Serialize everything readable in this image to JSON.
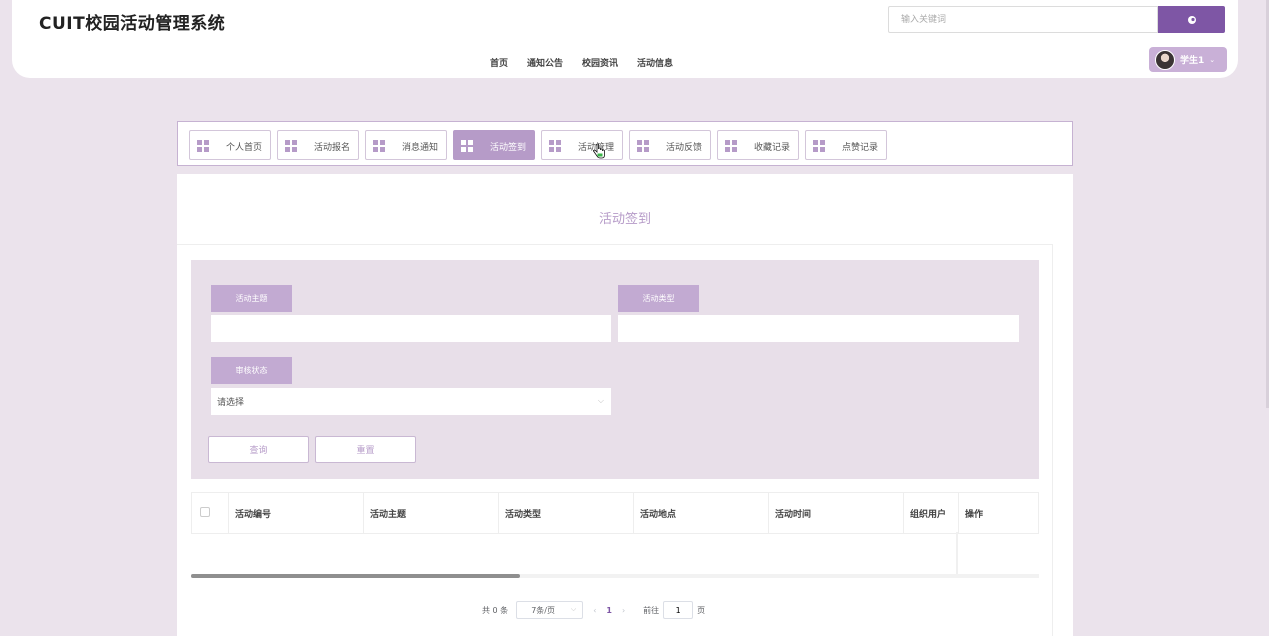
{
  "header": {
    "logo": "CUIT校园活动管理系统",
    "nav": [
      "首页",
      "通知公告",
      "校园资讯",
      "活动信息"
    ],
    "search": {
      "placeholder": "输入关键词",
      "button_icon": "search-icon"
    },
    "user": {
      "name": "学生1",
      "caret": "⌄",
      "avatar": "user-avatar"
    }
  },
  "tabs": {
    "items": [
      "个人首页",
      "活动报名",
      "消息通知",
      "活动签到",
      "活动管理",
      "活动反馈",
      "收藏记录",
      "点赞记录"
    ],
    "active": "活动签到",
    "icon": "grid-icon"
  },
  "page": {
    "title": "活动签到",
    "filters": {
      "theme_label": "活动主题",
      "type_label": "活动类型",
      "status_label": "审核状态",
      "status_value": "请选择",
      "theme_value": "",
      "type_value": "",
      "query_button": "查询",
      "reset_button": "重置"
    },
    "table": {
      "columns": [
        "活动编号",
        "活动主题",
        "活动类型",
        "活动地点",
        "活动时间",
        "组织用户",
        "操作"
      ],
      "rows": []
    },
    "pagination": {
      "total": "共 0 条",
      "page_size": "7条/页",
      "prev": "‹",
      "current_page": "1",
      "next": "›",
      "goto_label": "前往",
      "goto_value": "1",
      "page_suffix": "页"
    }
  },
  "colors": {
    "accent": "#7e56a5",
    "tab_active": "#b69bc8",
    "filter_bg": "#e8dfe9",
    "page_bg": "#ebe3ec"
  }
}
